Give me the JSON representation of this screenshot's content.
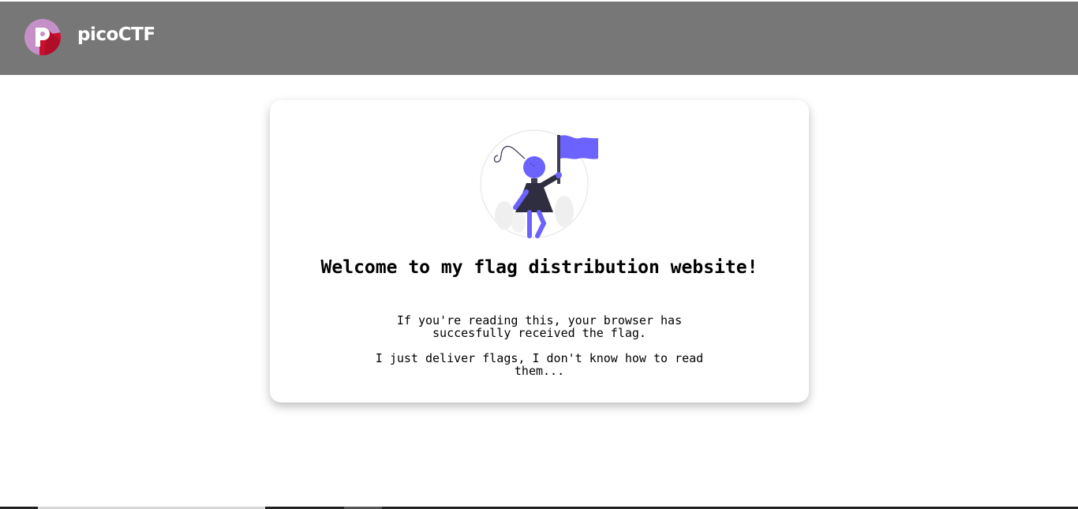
{
  "header": {
    "brand": "picoCTF",
    "logo_icon": "picoctf-logo-icon",
    "background": "#777777"
  },
  "card": {
    "illustration": "person-with-flag-illustration",
    "headline": "Welcome to my flag distribution website!",
    "paragraph_1": "If you're reading this, your browser has succesfully received the flag.",
    "paragraph_2": "I just deliver flags, I don't know how to read them...",
    "accent_color": "#6c63ff"
  }
}
